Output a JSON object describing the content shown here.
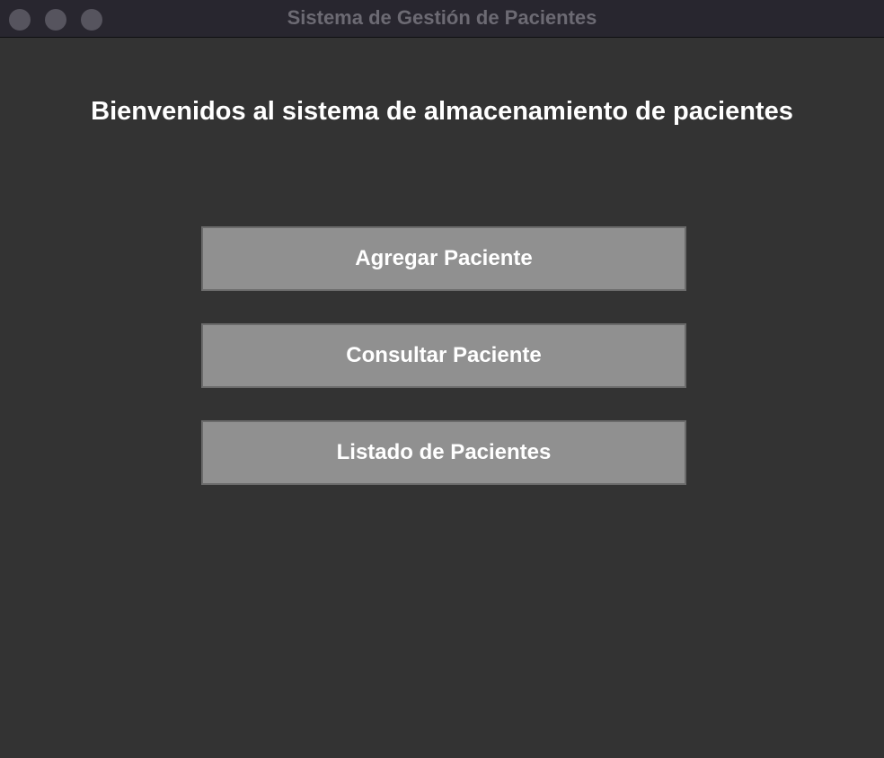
{
  "window": {
    "title": "Sistema de Gestión de Pacientes"
  },
  "main": {
    "heading": "Bienvenidos al sistema de almacenamiento de pacientes",
    "buttons": [
      {
        "label": "Agregar Paciente"
      },
      {
        "label": "Consultar Paciente"
      },
      {
        "label": "Listado de Pacientes"
      }
    ]
  },
  "colors": {
    "background": "#333333",
    "titlebar": "#28262f",
    "button_fill": "#909090",
    "button_border": "#6b6b6b",
    "text": "#ffffff"
  }
}
